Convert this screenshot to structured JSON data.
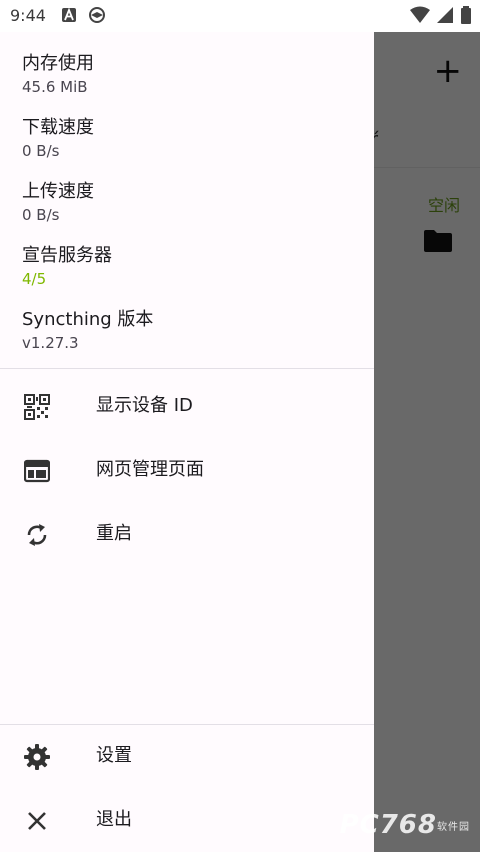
{
  "status_bar": {
    "time": "9:44"
  },
  "background_app": {
    "add_icon": "plus-icon",
    "partial_tab_text": "ŕ",
    "folder_status": "空闲",
    "folder_icon": "folder-icon"
  },
  "drawer": {
    "stats": [
      {
        "label": "内存使用",
        "value": "45.6 MiB"
      },
      {
        "label": "下载速度",
        "value": "0 B/s"
      },
      {
        "label": "上传速度",
        "value": "0 B/s"
      },
      {
        "label": "宣告服务器",
        "value": "4/5"
      },
      {
        "label": "Syncthing 版本",
        "value": "v1.27.3"
      }
    ],
    "menu": [
      {
        "label": "显示设备 ID",
        "icon": "qr-code-icon"
      },
      {
        "label": "网页管理页面",
        "icon": "web-page-icon"
      },
      {
        "label": "重启",
        "icon": "restart-icon"
      }
    ],
    "footer_menu": [
      {
        "label": "设置",
        "icon": "gear-icon"
      },
      {
        "label": "退出",
        "icon": "close-icon"
      }
    ]
  },
  "colors": {
    "drawer_bg": "#fffbfe",
    "accent_green": "#7fb800",
    "scrim": "#5f5f63"
  },
  "watermark": {
    "text": "PC768",
    "subtext": "软件园"
  }
}
